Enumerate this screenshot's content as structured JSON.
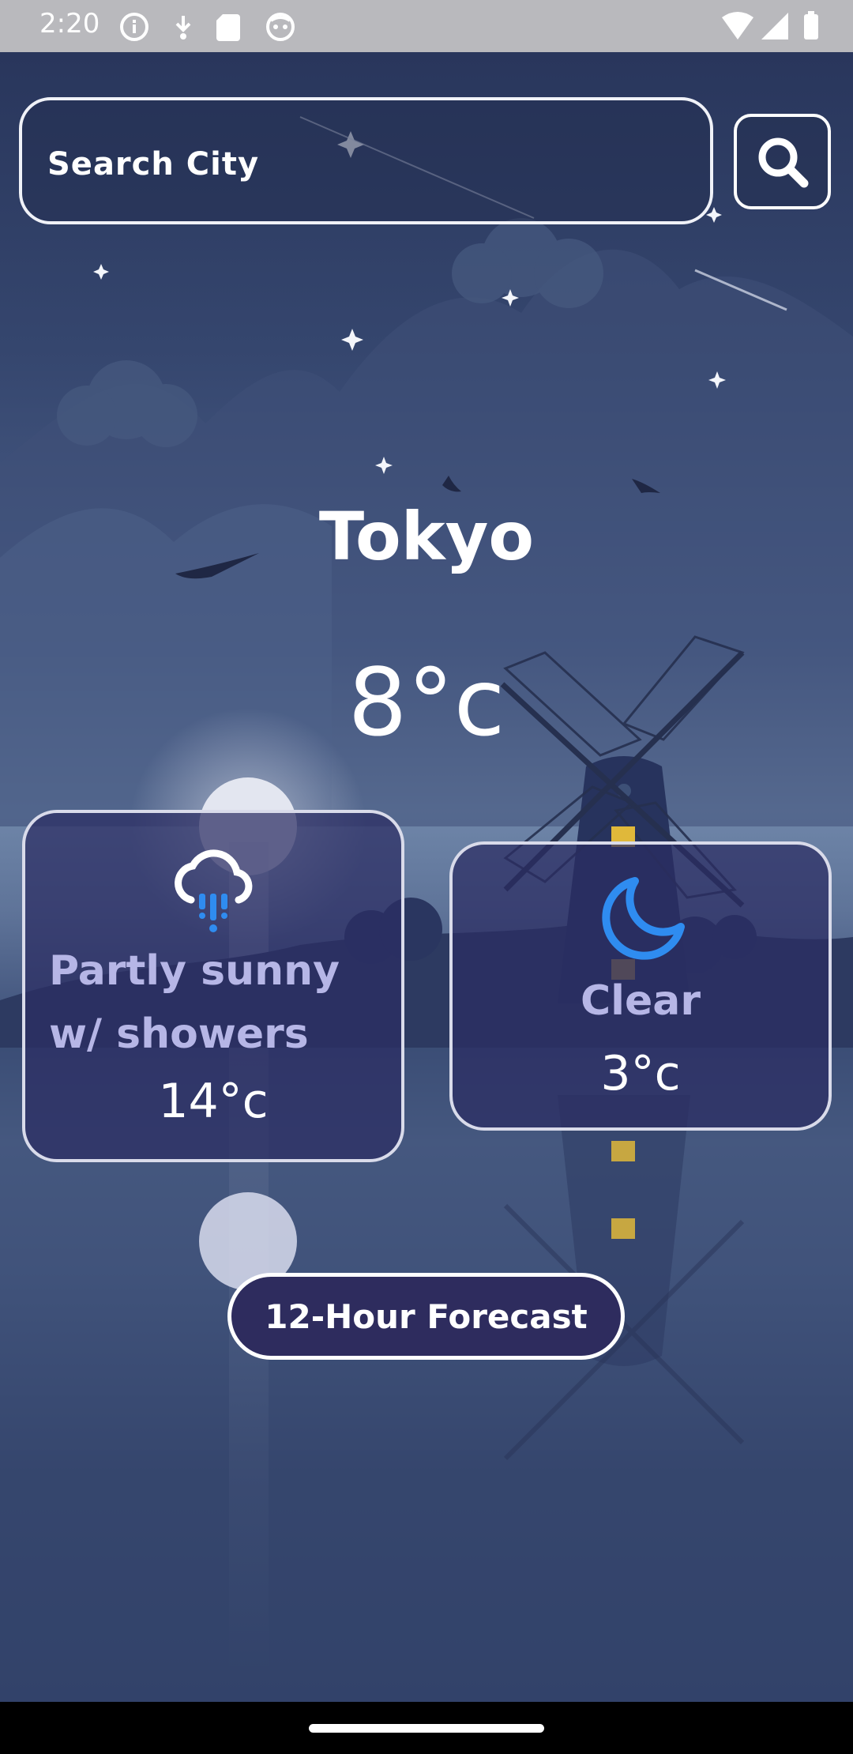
{
  "status_bar": {
    "time": "2:20",
    "left_icons": [
      "info-icon",
      "download-arrow-icon",
      "sd-card-icon",
      "face-icon"
    ],
    "right_icons": [
      "wifi-icon",
      "signal-icon",
      "battery-icon"
    ]
  },
  "search": {
    "placeholder": "Search City",
    "button_icon": "search-icon"
  },
  "weather": {
    "city": "Tokyo",
    "temperature": "8°c"
  },
  "day_card": {
    "icon": "rain-cloud-icon",
    "condition": "Partly sunny w/ showers",
    "temperature": "14°c"
  },
  "night_card": {
    "icon": "crescent-moon-icon",
    "condition": "Clear",
    "temperature": "3°c"
  },
  "forecast_button": {
    "label": "12-Hour Forecast"
  },
  "colors": {
    "card_background": "#2b2d62",
    "card_text": "#b6b6e6",
    "icon_blue": "#2f8cf0"
  }
}
